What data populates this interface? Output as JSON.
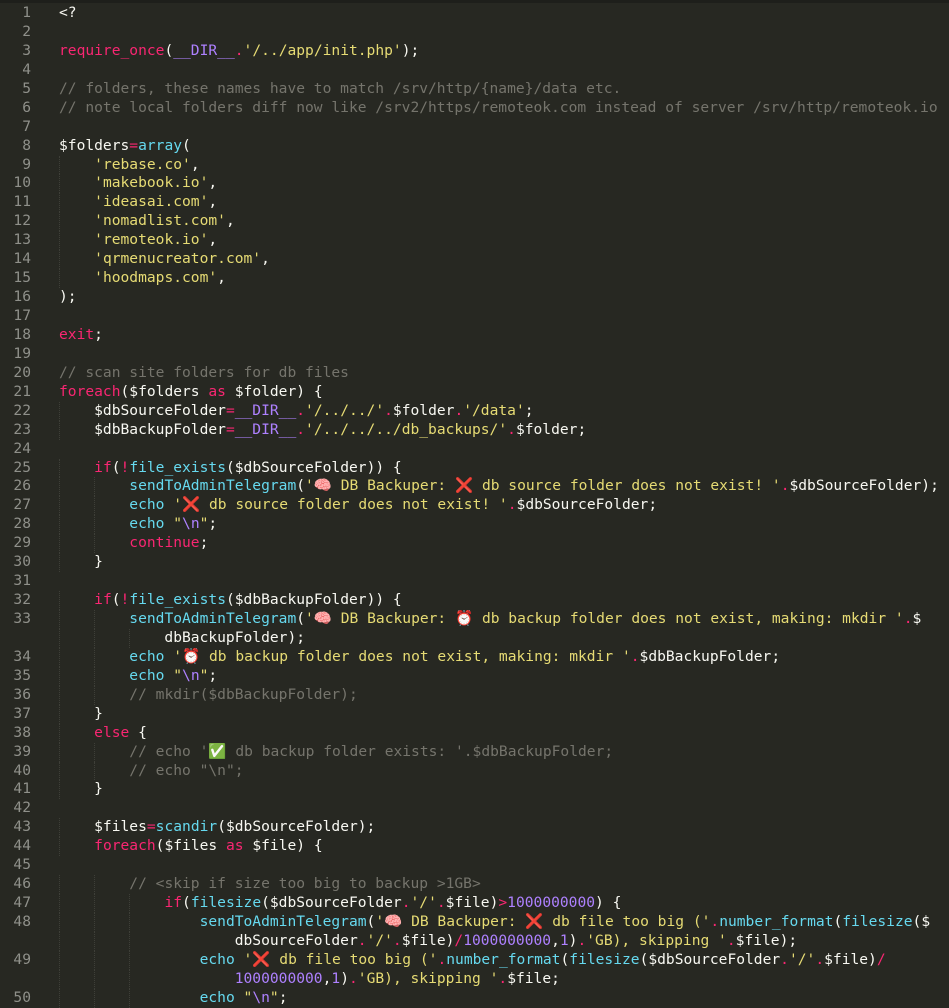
{
  "editor": {
    "theme_colors": {
      "background": "#272822",
      "keyword": "#f92672",
      "function": "#66d9ef",
      "string": "#e6db74",
      "constant": "#ae81ff",
      "comment": "#75746c",
      "plain": "#f8f8f2",
      "gutter": "#8f908a"
    },
    "lines": [
      {
        "n": "1",
        "rows": [
          [
            [
              "p",
              "<?"
            ]
          ]
        ]
      },
      {
        "n": "2",
        "rows": [
          []
        ]
      },
      {
        "n": "3",
        "rows": [
          [
            [
              "k",
              "require_once"
            ],
            [
              "p",
              "("
            ],
            [
              "n",
              "__DIR__"
            ],
            [
              "k",
              "."
            ],
            [
              "s",
              "'/../app/init.php'"
            ],
            [
              "p",
              ");"
            ]
          ]
        ]
      },
      {
        "n": "4",
        "rows": [
          []
        ]
      },
      {
        "n": "5",
        "rows": [
          [
            [
              "c",
              "// folders, these names have to match /srv/http/{name}/data etc."
            ]
          ]
        ]
      },
      {
        "n": "6",
        "rows": [
          [
            [
              "c",
              "// note local folders diff now like /srv2/https/remoteok.com instead of server /srv/http/remoteok.io"
            ]
          ]
        ]
      },
      {
        "n": "7",
        "rows": [
          []
        ]
      },
      {
        "n": "8",
        "rows": [
          [
            [
              "p",
              "$folders"
            ],
            [
              "k",
              "="
            ],
            [
              "f",
              "array"
            ],
            [
              "p",
              "("
            ]
          ]
        ]
      },
      {
        "n": "9",
        "rows": [
          [
            [
              "p",
              "    "
            ],
            [
              "s",
              "'rebase.co'"
            ],
            [
              "p",
              ","
            ]
          ]
        ]
      },
      {
        "n": "10",
        "rows": [
          [
            [
              "p",
              "    "
            ],
            [
              "s",
              "'makebook.io'"
            ],
            [
              "p",
              ","
            ]
          ]
        ]
      },
      {
        "n": "11",
        "rows": [
          [
            [
              "p",
              "    "
            ],
            [
              "s",
              "'ideasai.com'"
            ],
            [
              "p",
              ","
            ]
          ]
        ]
      },
      {
        "n": "12",
        "rows": [
          [
            [
              "p",
              "    "
            ],
            [
              "s",
              "'nomadlist.com'"
            ],
            [
              "p",
              ","
            ]
          ]
        ]
      },
      {
        "n": "13",
        "rows": [
          [
            [
              "p",
              "    "
            ],
            [
              "s",
              "'remoteok.io'"
            ],
            [
              "p",
              ","
            ]
          ]
        ]
      },
      {
        "n": "14",
        "rows": [
          [
            [
              "p",
              "    "
            ],
            [
              "s",
              "'qrmenucreator.com'"
            ],
            [
              "p",
              ","
            ]
          ]
        ]
      },
      {
        "n": "15",
        "rows": [
          [
            [
              "p",
              "    "
            ],
            [
              "s",
              "'hoodmaps.com'"
            ],
            [
              "p",
              ","
            ]
          ]
        ]
      },
      {
        "n": "16",
        "rows": [
          [
            [
              "p",
              ");"
            ]
          ]
        ]
      },
      {
        "n": "17",
        "rows": [
          []
        ]
      },
      {
        "n": "18",
        "rows": [
          [
            [
              "k",
              "exit"
            ],
            [
              "p",
              ";"
            ]
          ]
        ]
      },
      {
        "n": "19",
        "rows": [
          []
        ]
      },
      {
        "n": "20",
        "rows": [
          [
            [
              "c",
              "// scan site folders for db files"
            ]
          ]
        ]
      },
      {
        "n": "21",
        "rows": [
          [
            [
              "k",
              "foreach"
            ],
            [
              "p",
              "($folders "
            ],
            [
              "k",
              "as"
            ],
            [
              "p",
              " $folder) {"
            ]
          ]
        ]
      },
      {
        "n": "22",
        "rows": [
          [
            [
              "p",
              "    $dbSourceFolder"
            ],
            [
              "k",
              "="
            ],
            [
              "n",
              "__DIR__"
            ],
            [
              "k",
              "."
            ],
            [
              "s",
              "'/../../'"
            ],
            [
              "k",
              "."
            ],
            [
              "p",
              "$folder"
            ],
            [
              "k",
              "."
            ],
            [
              "s",
              "'/data'"
            ],
            [
              "p",
              ";"
            ]
          ]
        ]
      },
      {
        "n": "23",
        "rows": [
          [
            [
              "p",
              "    $dbBackupFolder"
            ],
            [
              "k",
              "="
            ],
            [
              "n",
              "__DIR__"
            ],
            [
              "k",
              "."
            ],
            [
              "s",
              "'/../../../db_backups/'"
            ],
            [
              "k",
              "."
            ],
            [
              "p",
              "$folder;"
            ]
          ]
        ]
      },
      {
        "n": "24",
        "rows": [
          []
        ]
      },
      {
        "n": "25",
        "rows": [
          [
            [
              "p",
              "    "
            ],
            [
              "k",
              "if"
            ],
            [
              "p",
              "("
            ],
            [
              "k",
              "!"
            ],
            [
              "f",
              "file_exists"
            ],
            [
              "p",
              "($dbSourceFolder)) {"
            ]
          ]
        ]
      },
      {
        "n": "26",
        "rows": [
          [
            [
              "p",
              "        "
            ],
            [
              "f",
              "sendToAdminTelegram"
            ],
            [
              "p",
              "("
            ],
            [
              "s",
              "'🧠 DB Backuper: ❌ db source folder does not exist! '"
            ],
            [
              "k",
              "."
            ],
            [
              "p",
              "$dbSourceFolder);"
            ]
          ]
        ]
      },
      {
        "n": "27",
        "rows": [
          [
            [
              "p",
              "        "
            ],
            [
              "f",
              "echo"
            ],
            [
              "p",
              " "
            ],
            [
              "s",
              "'❌ db source folder does not exist! '"
            ],
            [
              "k",
              "."
            ],
            [
              "p",
              "$dbSourceFolder;"
            ]
          ]
        ]
      },
      {
        "n": "28",
        "rows": [
          [
            [
              "p",
              "        "
            ],
            [
              "f",
              "echo"
            ],
            [
              "p",
              " "
            ],
            [
              "s",
              "\""
            ],
            [
              "n",
              "\\n"
            ],
            [
              "s",
              "\""
            ],
            [
              "p",
              ";"
            ]
          ]
        ]
      },
      {
        "n": "29",
        "rows": [
          [
            [
              "p",
              "        "
            ],
            [
              "k",
              "continue"
            ],
            [
              "p",
              ";"
            ]
          ]
        ]
      },
      {
        "n": "30",
        "rows": [
          [
            [
              "p",
              "    }"
            ]
          ]
        ]
      },
      {
        "n": "31",
        "rows": [
          []
        ]
      },
      {
        "n": "32",
        "rows": [
          [
            [
              "p",
              "    "
            ],
            [
              "k",
              "if"
            ],
            [
              "p",
              "("
            ],
            [
              "k",
              "!"
            ],
            [
              "f",
              "file_exists"
            ],
            [
              "p",
              "($dbBackupFolder)) {"
            ]
          ]
        ]
      },
      {
        "n": "33",
        "rows": [
          [
            [
              "p",
              "        "
            ],
            [
              "f",
              "sendToAdminTelegram"
            ],
            [
              "p",
              "("
            ],
            [
              "s",
              "'🧠 DB Backuper: ⏰ db backup folder does not exist, making: mkdir '"
            ],
            [
              "k",
              "."
            ],
            [
              "p",
              "$"
            ]
          ],
          [
            [
              "p",
              "            dbBackupFolder);"
            ]
          ]
        ]
      },
      {
        "n": "34",
        "rows": [
          [
            [
              "p",
              "        "
            ],
            [
              "f",
              "echo"
            ],
            [
              "p",
              " "
            ],
            [
              "s",
              "'⏰ db backup folder does not exist, making: mkdir '"
            ],
            [
              "k",
              "."
            ],
            [
              "p",
              "$dbBackupFolder;"
            ]
          ]
        ]
      },
      {
        "n": "35",
        "rows": [
          [
            [
              "p",
              "        "
            ],
            [
              "f",
              "echo"
            ],
            [
              "p",
              " "
            ],
            [
              "s",
              "\""
            ],
            [
              "n",
              "\\n"
            ],
            [
              "s",
              "\""
            ],
            [
              "p",
              ";"
            ]
          ]
        ]
      },
      {
        "n": "36",
        "rows": [
          [
            [
              "p",
              "        "
            ],
            [
              "c",
              "// mkdir($dbBackupFolder);"
            ]
          ]
        ]
      },
      {
        "n": "37",
        "rows": [
          [
            [
              "p",
              "    }"
            ]
          ]
        ]
      },
      {
        "n": "38",
        "rows": [
          [
            [
              "p",
              "    "
            ],
            [
              "k",
              "else"
            ],
            [
              "p",
              " {"
            ]
          ]
        ]
      },
      {
        "n": "39",
        "rows": [
          [
            [
              "p",
              "        "
            ],
            [
              "c",
              "// echo '✅ db backup folder exists: '.$dbBackupFolder;"
            ]
          ]
        ]
      },
      {
        "n": "40",
        "rows": [
          [
            [
              "p",
              "        "
            ],
            [
              "c",
              "// echo \"\\n\";"
            ]
          ]
        ]
      },
      {
        "n": "41",
        "rows": [
          [
            [
              "p",
              "    }"
            ]
          ]
        ]
      },
      {
        "n": "42",
        "rows": [
          []
        ]
      },
      {
        "n": "43",
        "rows": [
          [
            [
              "p",
              "    $files"
            ],
            [
              "k",
              "="
            ],
            [
              "f",
              "scandir"
            ],
            [
              "p",
              "($dbSourceFolder);"
            ]
          ]
        ]
      },
      {
        "n": "44",
        "rows": [
          [
            [
              "p",
              "    "
            ],
            [
              "k",
              "foreach"
            ],
            [
              "p",
              "($files "
            ],
            [
              "k",
              "as"
            ],
            [
              "p",
              " $file) {"
            ]
          ]
        ]
      },
      {
        "n": "45",
        "rows": [
          []
        ]
      },
      {
        "n": "46",
        "rows": [
          [
            [
              "p",
              "        "
            ],
            [
              "c",
              "// <skip if size too big to backup >1GB>"
            ]
          ]
        ]
      },
      {
        "n": "47",
        "rows": [
          [
            [
              "p",
              "            "
            ],
            [
              "k",
              "if"
            ],
            [
              "p",
              "("
            ],
            [
              "f",
              "filesize"
            ],
            [
              "p",
              "($dbSourceFolder"
            ],
            [
              "k",
              "."
            ],
            [
              "s",
              "'/'"
            ],
            [
              "k",
              "."
            ],
            [
              "p",
              "$file)"
            ],
            [
              "k",
              ">"
            ],
            [
              "n",
              "1000000000"
            ],
            [
              "p",
              ") {"
            ]
          ]
        ]
      },
      {
        "n": "48",
        "rows": [
          [
            [
              "p",
              "                "
            ],
            [
              "f",
              "sendToAdminTelegram"
            ],
            [
              "p",
              "("
            ],
            [
              "s",
              "'🧠 DB Backuper: ❌ db file too big ('"
            ],
            [
              "k",
              "."
            ],
            [
              "f",
              "number_format"
            ],
            [
              "p",
              "("
            ],
            [
              "f",
              "filesize"
            ],
            [
              "p",
              "($"
            ]
          ],
          [
            [
              "p",
              "                    dbSourceFolder"
            ],
            [
              "k",
              "."
            ],
            [
              "s",
              "'/'"
            ],
            [
              "k",
              "."
            ],
            [
              "p",
              "$file)"
            ],
            [
              "k",
              "/"
            ],
            [
              "n",
              "1000000000"
            ],
            [
              "p",
              ","
            ],
            [
              "n",
              "1"
            ],
            [
              "p",
              ")"
            ],
            [
              "k",
              "."
            ],
            [
              "s",
              "'GB), skipping '"
            ],
            [
              "k",
              "."
            ],
            [
              "p",
              "$file);"
            ]
          ]
        ]
      },
      {
        "n": "49",
        "rows": [
          [
            [
              "p",
              "                "
            ],
            [
              "f",
              "echo"
            ],
            [
              "p",
              " "
            ],
            [
              "s",
              "'❌ db file too big ('"
            ],
            [
              "k",
              "."
            ],
            [
              "f",
              "number_format"
            ],
            [
              "p",
              "("
            ],
            [
              "f",
              "filesize"
            ],
            [
              "p",
              "($dbSourceFolder"
            ],
            [
              "k",
              "."
            ],
            [
              "s",
              "'/'"
            ],
            [
              "k",
              "."
            ],
            [
              "p",
              "$file)"
            ],
            [
              "k",
              "/"
            ]
          ],
          [
            [
              "p",
              "                    "
            ],
            [
              "n",
              "1000000000"
            ],
            [
              "p",
              ","
            ],
            [
              "n",
              "1"
            ],
            [
              "p",
              ")"
            ],
            [
              "k",
              "."
            ],
            [
              "s",
              "'GB), skipping '"
            ],
            [
              "k",
              "."
            ],
            [
              "p",
              "$file;"
            ]
          ]
        ]
      },
      {
        "n": "50",
        "rows": [
          [
            [
              "p",
              "                "
            ],
            [
              "f",
              "echo"
            ],
            [
              "p",
              " "
            ],
            [
              "s",
              "\""
            ],
            [
              "n",
              "\\n"
            ],
            [
              "s",
              "\""
            ],
            [
              "p",
              ";"
            ]
          ]
        ]
      }
    ]
  }
}
